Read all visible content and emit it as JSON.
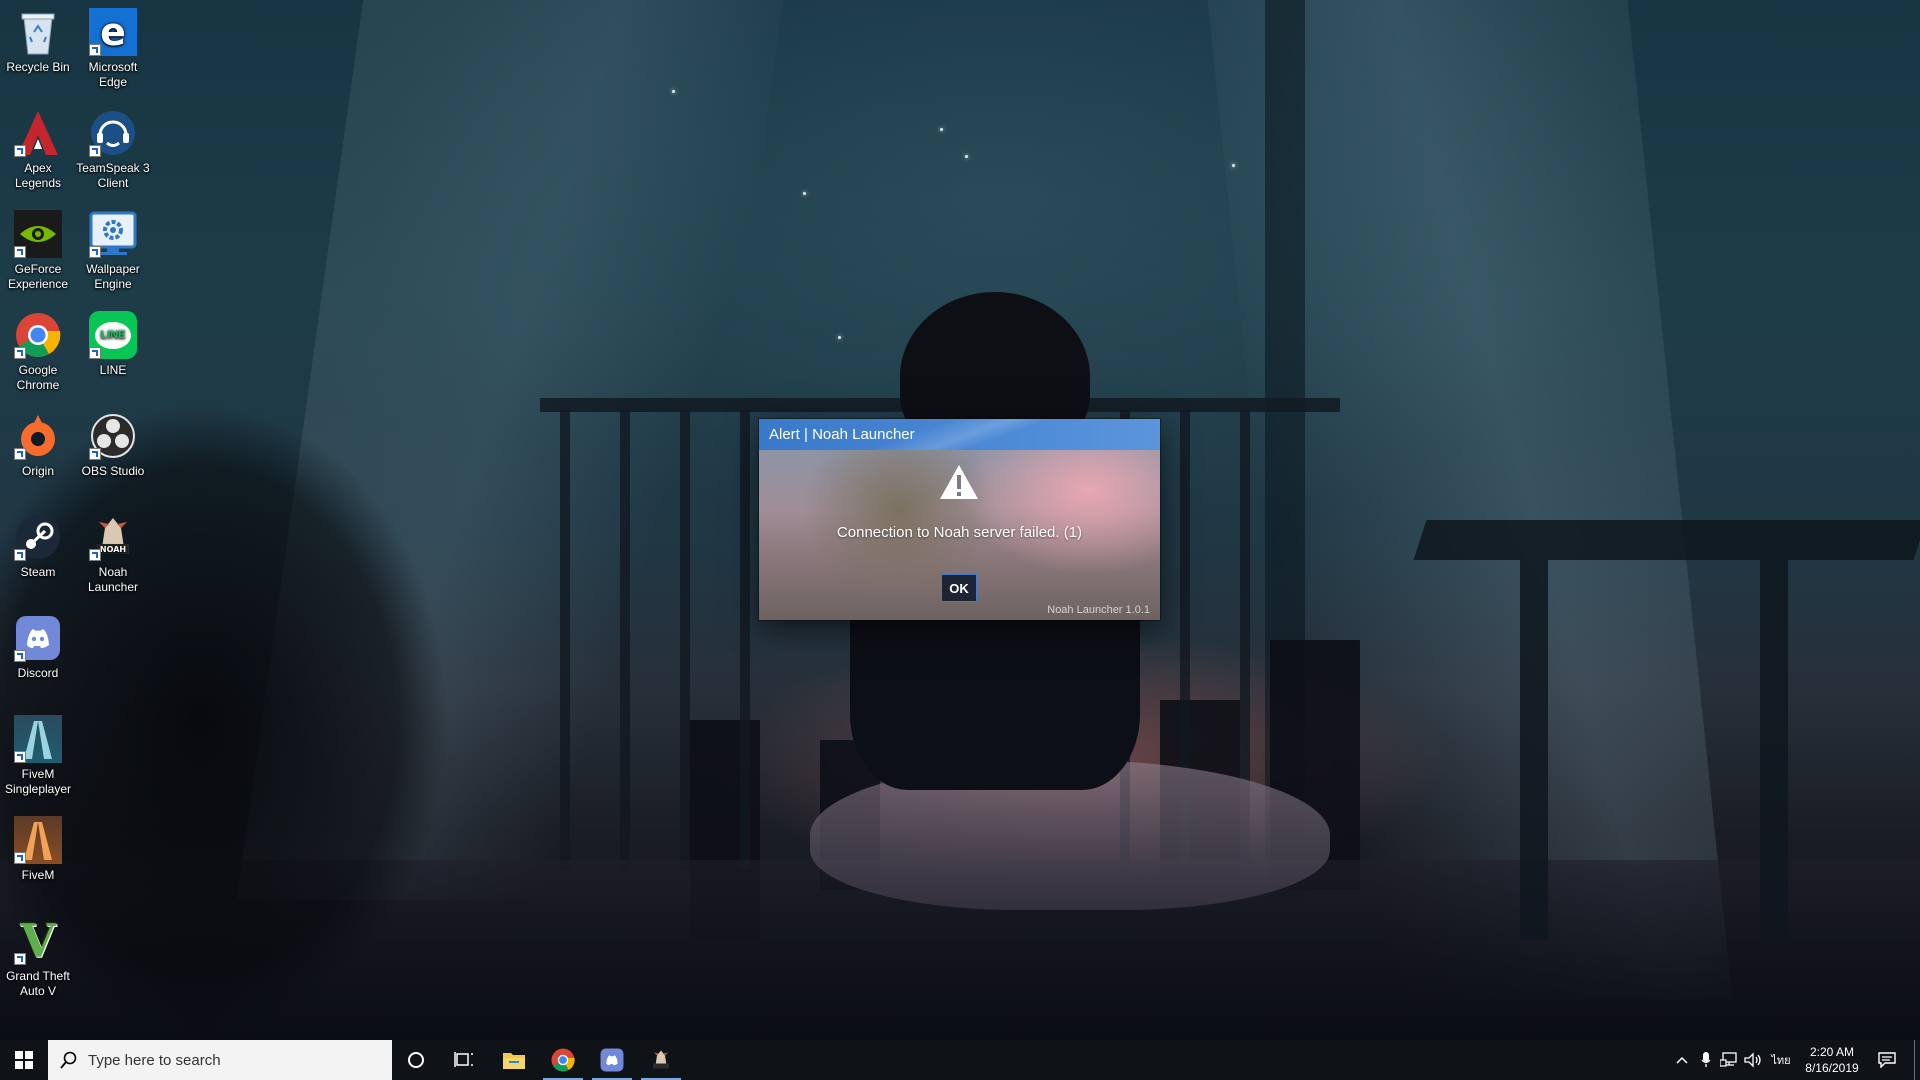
{
  "desktop_icons": [
    {
      "label": "Recycle Bin",
      "icon": "recycle-bin-icon"
    },
    {
      "label": "Microsoft Edge",
      "icon": "edge-icon"
    },
    {
      "label": "Apex Legends",
      "icon": "apex-legends-icon"
    },
    {
      "label": "TeamSpeak 3 Client",
      "icon": "teamspeak-icon"
    },
    {
      "label": "GeForce Experience",
      "icon": "geforce-icon"
    },
    {
      "label": "Wallpaper Engine",
      "icon": "wallpaper-engine-icon"
    },
    {
      "label": "Google Chrome",
      "icon": "chrome-icon"
    },
    {
      "label": "LINE",
      "icon": "line-icon"
    },
    {
      "label": "Origin",
      "icon": "origin-icon"
    },
    {
      "label": "OBS Studio",
      "icon": "obs-icon"
    },
    {
      "label": "Steam",
      "icon": "steam-icon"
    },
    {
      "label": "Noah Launcher",
      "icon": "noah-launcher-icon"
    },
    {
      "label": "Discord",
      "icon": "discord-icon"
    },
    {
      "label": "FiveM Singleplayer",
      "icon": "fivem-singleplayer-icon"
    },
    {
      "label": "FiveM",
      "icon": "fivem-icon"
    },
    {
      "label": "Grand Theft Auto V",
      "icon": "gta-v-icon"
    }
  ],
  "icon_glyphs": {
    "edge": "e",
    "apex": "A",
    "line": "LINE",
    "gta": "V"
  },
  "dialog": {
    "title": "Alert | Noah Launcher",
    "message": "Connection to Noah server failed. (1)",
    "ok_label": "OK",
    "version": "Noah Launcher 1.0.1",
    "warning_icon": "warning-icon"
  },
  "taskbar": {
    "search_placeholder": "Type here to search",
    "pinned": [
      "cortana-icon",
      "task-view-icon",
      "file-explorer-icon",
      "chrome-icon",
      "discord-icon",
      "noah-launcher-icon"
    ],
    "input_indicator": "ไทย",
    "time": "2:20 AM",
    "date": "8/16/2019"
  },
  "colors": {
    "titlebar": "#3a78c9",
    "taskbar": "#0f1217",
    "accent": "#76a8e6"
  }
}
